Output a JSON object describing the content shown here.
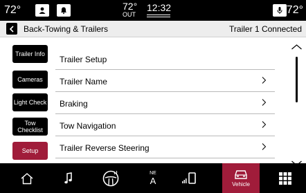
{
  "status": {
    "temp_left": "72°",
    "temp_right": "72°",
    "outside_temp": "72°",
    "outside_label": "OUT",
    "time": "12:32"
  },
  "header": {
    "title": "Back-Towing & Trailers",
    "status": "Trailer 1 Connected"
  },
  "side_tabs": [
    {
      "label": "Trailer Info"
    },
    {
      "label": "Cameras"
    },
    {
      "label": "Light Check"
    },
    {
      "label": "Tow Checklist"
    },
    {
      "label": "Setup"
    }
  ],
  "list": {
    "heading": "Trailer Setup",
    "items": [
      {
        "label": "Trailer Name"
      },
      {
        "label": "Braking"
      },
      {
        "label": "Tow Navigation"
      },
      {
        "label": "Trailer Reverse Steering"
      }
    ]
  },
  "compass": {
    "top": "NE",
    "letter": "A"
  },
  "bottom_nav": {
    "vehicle_label": "Vehicle"
  },
  "colors": {
    "accent": "#a01c3a"
  }
}
